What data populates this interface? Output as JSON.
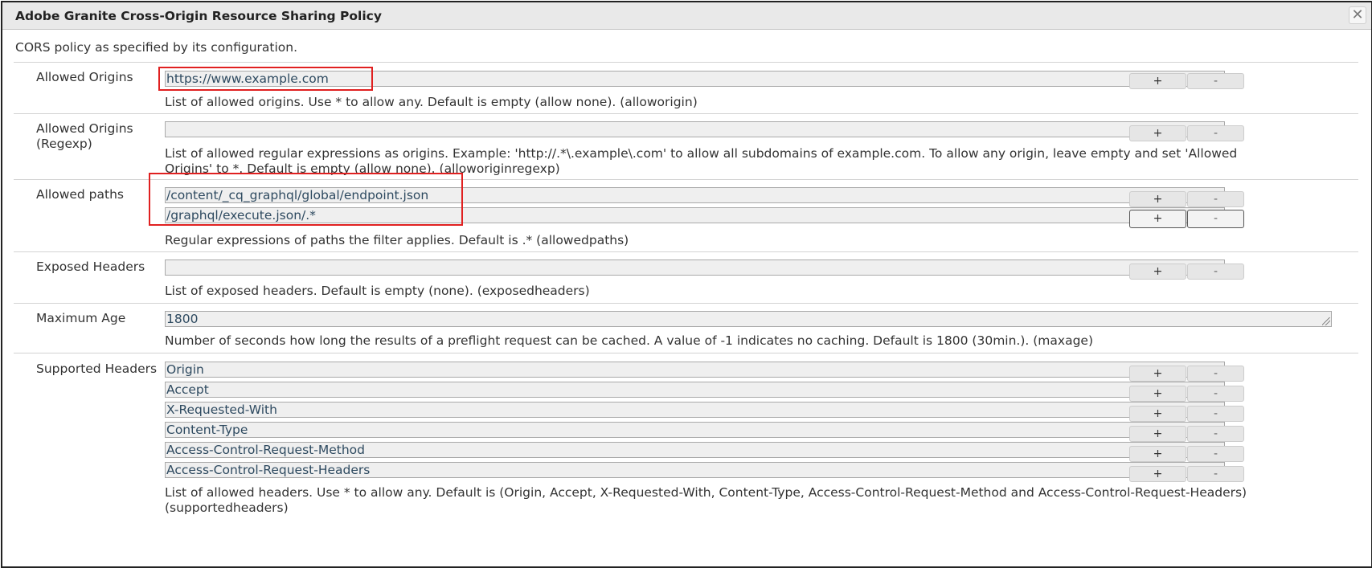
{
  "dialog": {
    "title": "Adobe Granite Cross-Origin Resource Sharing Policy",
    "close_icon": "✕",
    "description": "CORS policy as specified by its configuration."
  },
  "buttons": {
    "add": "+",
    "remove": "-"
  },
  "fields": {
    "allowed_origins": {
      "label": "Allowed Origins",
      "values": [
        "https://www.example.com"
      ],
      "help": "List of allowed origins. Use * to allow any. Default is empty (allow none). (alloworigin)"
    },
    "allowed_origins_regexp": {
      "label_line1": "Allowed Origins",
      "label_line2": "(Regexp)",
      "values": [
        ""
      ],
      "help_line1": "List of allowed regular expressions as origins. Example: 'http://.*\\.example\\.com' to allow all subdomains of example.com. To allow any origin, leave empty and set 'Allowed",
      "help_line2": "Origins' to *. Default is empty (allow none). (alloworiginregexp)"
    },
    "allowed_paths": {
      "label": "Allowed paths",
      "values": [
        "/content/_cq_graphql/global/endpoint.json",
        "/graphql/execute.json/.*"
      ],
      "help": "Regular expressions of paths the filter applies. Default is .* (allowedpaths)"
    },
    "exposed_headers": {
      "label": "Exposed Headers",
      "values": [
        ""
      ],
      "help": "List of exposed headers. Default is empty (none). (exposedheaders)"
    },
    "maximum_age": {
      "label": "Maximum Age",
      "value": "1800",
      "help": "Number of seconds how long the results of a preflight request can be cached. A value of -1 indicates no caching. Default is 1800 (30min.). (maxage)"
    },
    "supported_headers": {
      "label": "Supported Headers",
      "values": [
        "Origin",
        "Accept",
        "X-Requested-With",
        "Content-Type",
        "Access-Control-Request-Method",
        "Access-Control-Request-Headers"
      ],
      "help_line1": "List of allowed headers. Use * to allow any. Default is (Origin, Accept, X-Requested-With, Content-Type, Access-Control-Request-Method and Access-Control-Request-Headers)",
      "help_line2": "(supportedheaders)"
    }
  },
  "colors": {
    "highlight": "#e02020",
    "field_bg": "#efefef",
    "field_text": "#2e4a60"
  }
}
